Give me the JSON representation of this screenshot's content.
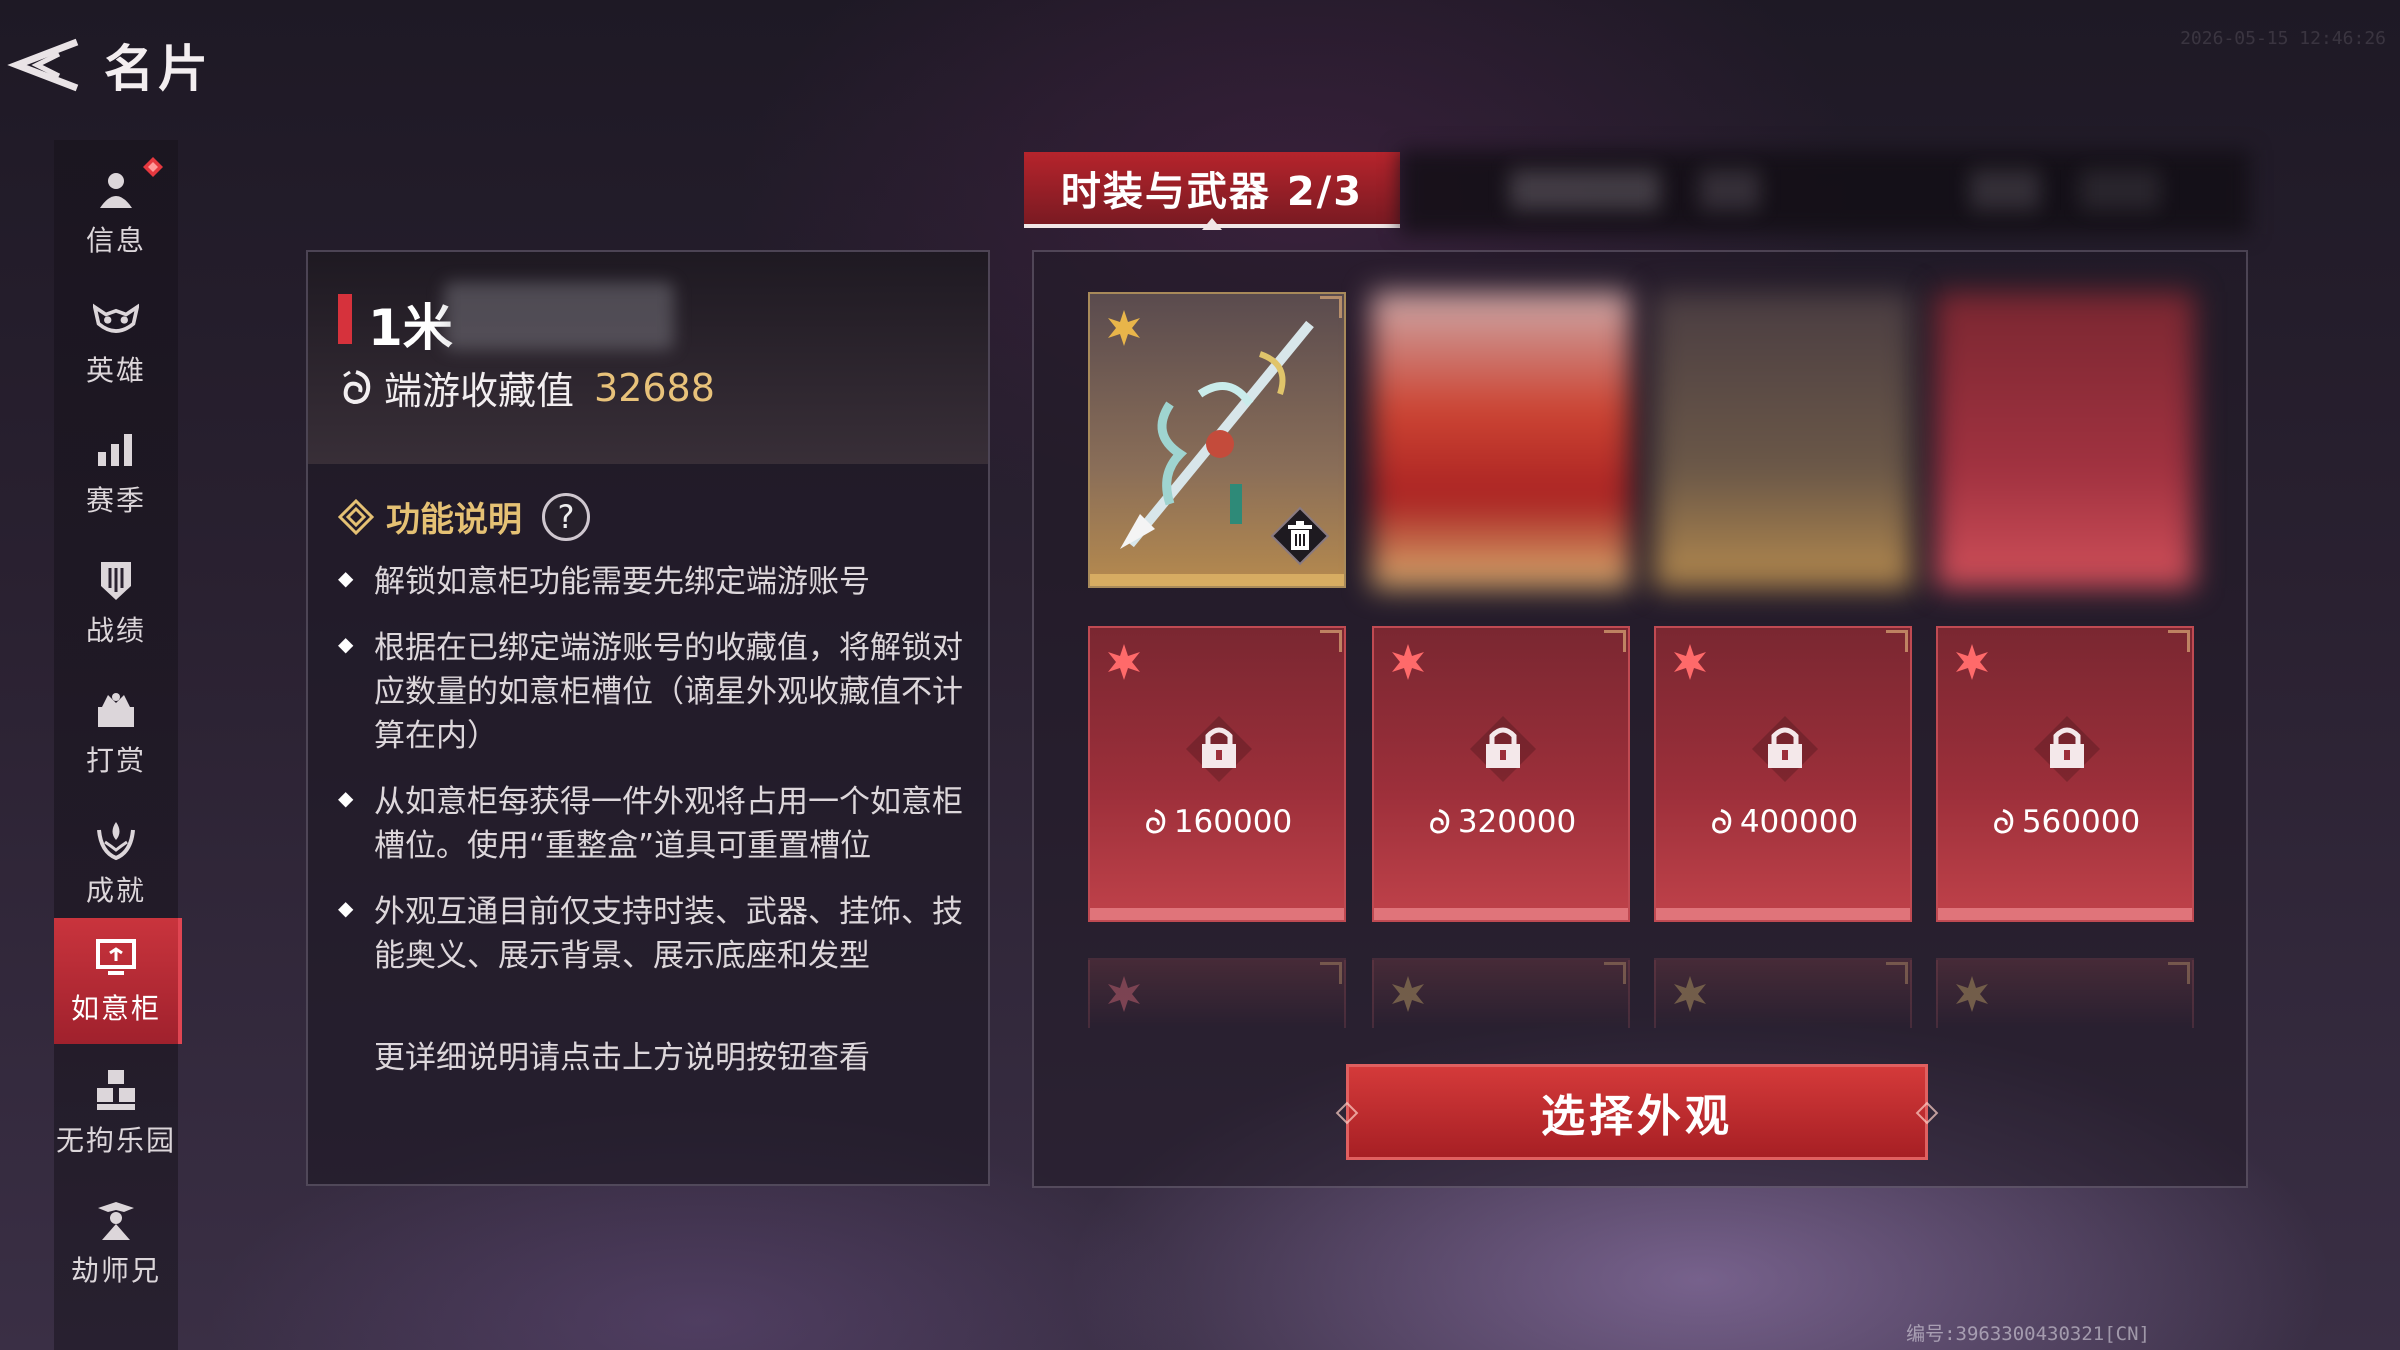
{
  "header": {
    "title": "名片",
    "timestamp": "2026-05-15 12:46:26"
  },
  "sidebar": {
    "items": [
      {
        "label": "信息",
        "icon": "person-icon",
        "has_notice": true
      },
      {
        "label": "英雄",
        "icon": "mask-icon"
      },
      {
        "label": "赛季",
        "icon": "bar-chart-icon"
      },
      {
        "label": "战绩",
        "icon": "shield-icon"
      },
      {
        "label": "打赏",
        "icon": "gift-icon"
      },
      {
        "label": "成就",
        "icon": "laurel-icon"
      },
      {
        "label": "如意柜",
        "icon": "cabinet-icon",
        "active": true
      },
      {
        "label": "无拘乐园",
        "icon": "blocks-icon"
      },
      {
        "label": "劫师兄",
        "icon": "character-icon"
      }
    ]
  },
  "profile": {
    "name": "1米",
    "collection_label": "端游收藏值",
    "collection_value": "32688"
  },
  "function_info": {
    "title": "功能说明",
    "help_symbol": "?",
    "bullets": [
      "解锁如意柜功能需要先绑定端游账号",
      "根据在已绑定端游账号的收藏值，将解锁对应数量的如意柜槽位（谪星外观收藏值不计算在内）",
      "从如意柜每获得一件外观将占用一个如意柜槽位。使用“重整盒”道具可重置槽位",
      "外观互通目前仅支持时装、武器、挂饰、技能奥义、展示背景、展示底座和发型"
    ],
    "more": "更详细说明请点击上方说明按钮查看"
  },
  "tabs": {
    "active_label": "时装与武器 2/3"
  },
  "slots": {
    "locked": [
      {
        "cost": "160000"
      },
      {
        "cost": "320000"
      },
      {
        "cost": "400000"
      },
      {
        "cost": "560000"
      }
    ]
  },
  "actions": {
    "select_label": "选择外观"
  },
  "footer": {
    "code": "编号:3963300430321[CN]"
  },
  "colors": {
    "accent_red": "#c9343d",
    "gold": "#e8c27a",
    "locked_slot": "#9c2f3a"
  }
}
